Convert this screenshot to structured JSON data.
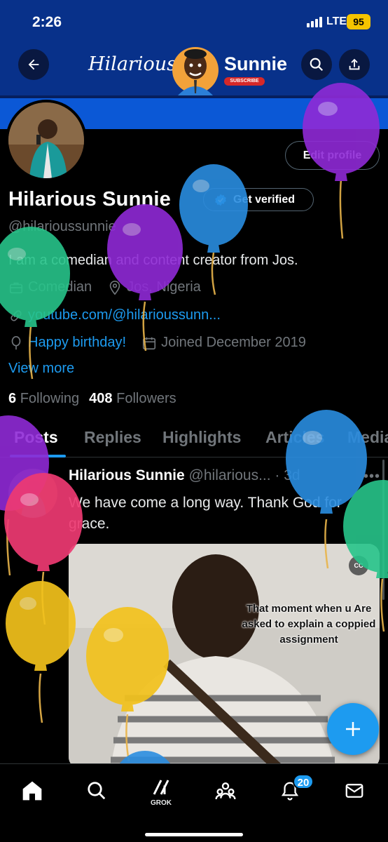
{
  "status_bar": {
    "time": "2:26",
    "network": "LTE",
    "battery": "95"
  },
  "banner": {
    "word1": "Hilarious",
    "word2": "Sunnie",
    "subscribe": "SUBSCRIBE"
  },
  "header": {
    "back_icon": "arrow-left-icon",
    "search_icon": "search-icon",
    "share_icon": "share-icon"
  },
  "profile": {
    "edit_profile": "Edit profile",
    "name": "Hilarious Sunnie",
    "get_verified": "Get verified",
    "handle": "@hilarioussunnie",
    "bio": "I am a comedian and content creator from Jos.",
    "category": "Comedian",
    "location": "Jos, Nigeria",
    "website": "youtube.com/@hilarioussunn...",
    "birthday": "Happy birthday!",
    "joined": "Joined December 2019",
    "view_more": "View more",
    "following_count": "6",
    "following_label": "Following",
    "followers_count": "408",
    "followers_label": "Followers"
  },
  "tabs": [
    "Posts",
    "Replies",
    "Highlights",
    "Articles",
    "Media"
  ],
  "post": {
    "author": "Hilarious Sunnie",
    "handle_time": "@hilarious... · 3d",
    "text": "We have come a long way. Thank God for grace.",
    "media_caption": "That moment when u Are asked to explain a coppied assignment",
    "cc": "CC"
  },
  "bottom_nav": {
    "grok_label": "GROK",
    "notifications_badge": "20"
  },
  "colors": {
    "accent": "#1d9bf0",
    "banner_blue": "#08318a",
    "background": "#000000"
  }
}
